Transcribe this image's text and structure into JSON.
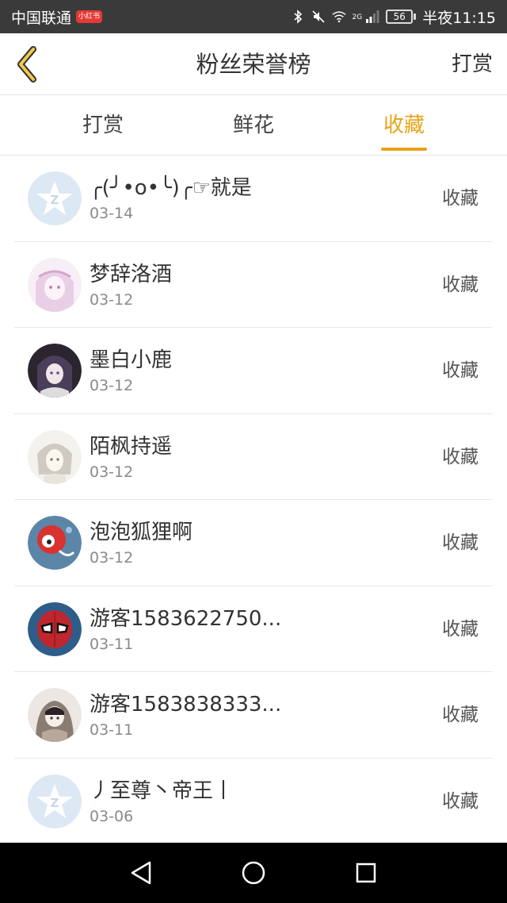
{
  "status_bar": {
    "carrier": "中国联通",
    "carrier_badge": "小红书",
    "network": "2G",
    "battery": "56",
    "time": "半夜11:15"
  },
  "header": {
    "title": "粉丝荣誉榜",
    "action_label": "打赏"
  },
  "tabs": [
    {
      "label": "打赏",
      "active": false
    },
    {
      "label": "鲜花",
      "active": false
    },
    {
      "label": "收藏",
      "active": true
    }
  ],
  "accent_color": "#e8a317",
  "list": [
    {
      "name": "╭(╯•o•╰)╭☞就是",
      "date": "03-14",
      "kind": "收藏",
      "avatar": "default"
    },
    {
      "name": "梦辞洛酒",
      "date": "03-12",
      "kind": "收藏",
      "avatar": "anime-pink"
    },
    {
      "name": "墨白小鹿",
      "date": "03-12",
      "kind": "收藏",
      "avatar": "anime-dark"
    },
    {
      "name": "陌枫持遥",
      "date": "03-12",
      "kind": "收藏",
      "avatar": "anime-light"
    },
    {
      "name": "泡泡狐狸啊",
      "date": "03-12",
      "kind": "收藏",
      "avatar": "cartoon-blue"
    },
    {
      "name": "游客1583622750...",
      "date": "03-11",
      "kind": "收藏",
      "avatar": "hero-red"
    },
    {
      "name": "游客1583838333...",
      "date": "03-11",
      "kind": "收藏",
      "avatar": "anime-hood"
    },
    {
      "name": "丿至尊丶帝王丨",
      "date": "03-06",
      "kind": "收藏",
      "avatar": "default"
    }
  ]
}
